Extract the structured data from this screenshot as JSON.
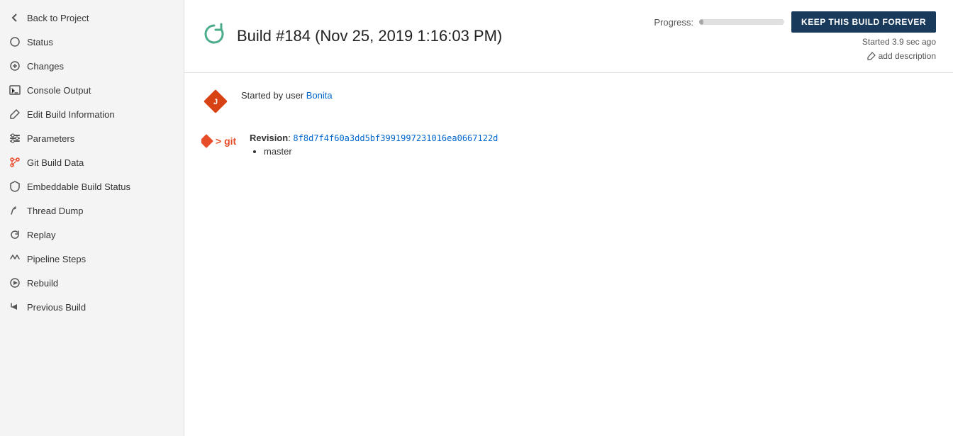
{
  "sidebar": {
    "back_label": "Back to Project",
    "items": [
      {
        "id": "status",
        "label": "Status",
        "icon": "circle-icon"
      },
      {
        "id": "changes",
        "label": "Changes",
        "icon": "changes-icon"
      },
      {
        "id": "console-output",
        "label": "Console Output",
        "icon": "console-icon"
      },
      {
        "id": "edit-build-info",
        "label": "Edit Build Information",
        "icon": "edit-icon"
      },
      {
        "id": "parameters",
        "label": "Parameters",
        "icon": "parameters-icon"
      },
      {
        "id": "git-build-data",
        "label": "Git Build Data",
        "icon": "git-data-icon"
      },
      {
        "id": "embeddable-build-status",
        "label": "Embeddable Build Status",
        "icon": "shield-icon"
      },
      {
        "id": "thread-dump",
        "label": "Thread Dump",
        "icon": "thread-icon"
      },
      {
        "id": "replay",
        "label": "Replay",
        "icon": "replay-icon"
      },
      {
        "id": "pipeline-steps",
        "label": "Pipeline Steps",
        "icon": "pipeline-icon"
      },
      {
        "id": "rebuild",
        "label": "Rebuild",
        "icon": "rebuild-icon"
      },
      {
        "id": "previous-build",
        "label": "Previous Build",
        "icon": "previous-icon"
      }
    ]
  },
  "header": {
    "build_title": "Build #184 (Nov 25, 2019 1:16:03 PM)",
    "progress_label": "Progress:",
    "progress_percent": 5,
    "keep_btn_label": "KEEP THIS BUILD FOREVER",
    "started_text": "Started 3.9 sec ago",
    "add_description_label": "add description"
  },
  "content": {
    "started_by_prefix": "Started by user ",
    "started_by_user": "Bonita",
    "revision_prefix": "Revision",
    "revision_hash": "8f8d7f4f60a3dd5bf3991997231016ea0667122d",
    "branch": "master"
  }
}
